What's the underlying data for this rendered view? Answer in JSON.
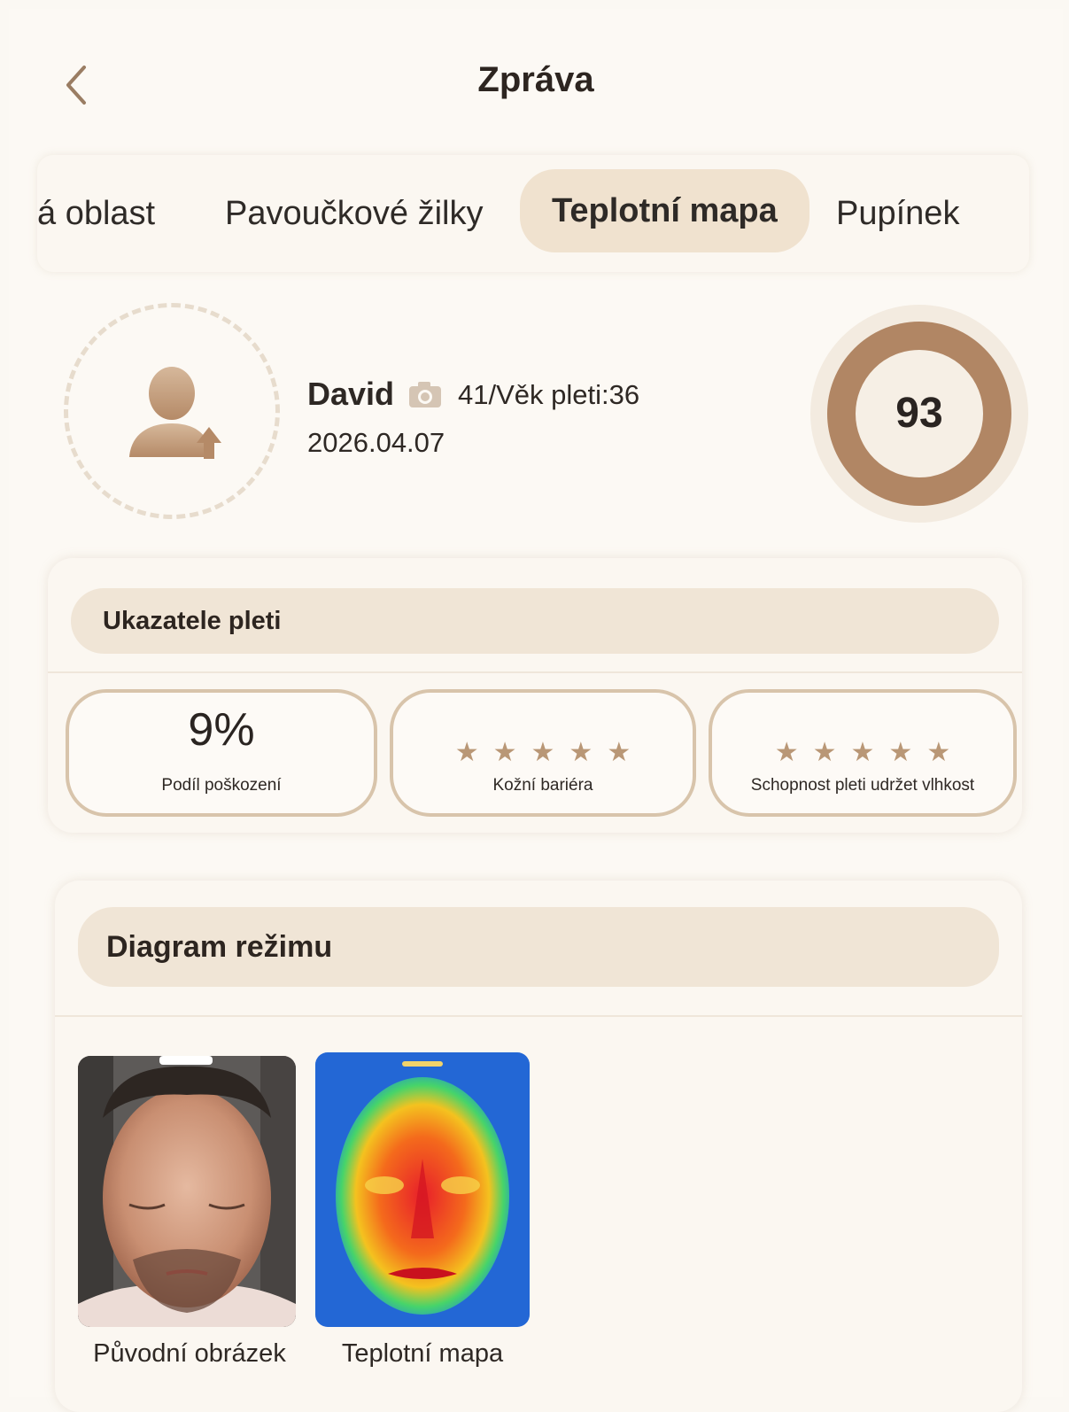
{
  "header": {
    "title": "Zpráva",
    "back_icon": "chevron-left-icon"
  },
  "tabs": [
    {
      "label": "á oblast",
      "active": false
    },
    {
      "label": "Pavoučkové žilky",
      "active": false
    },
    {
      "label": "Teplotní mapa",
      "active": true
    },
    {
      "label": "Pupínek",
      "active": false
    }
  ],
  "profile": {
    "name": "David",
    "age_info": "41/Věk pleti:36",
    "date": "2026.04.07",
    "score": "93",
    "camera_icon": "camera-icon",
    "avatar_icon": "user-upload-icon"
  },
  "indicators": {
    "title": "Ukazatele pleti",
    "metrics": [
      {
        "value": "9%",
        "label": "Podíl poškození"
      },
      {
        "stars": 5,
        "label": "Kožní bariéra"
      },
      {
        "stars": 5,
        "label": "Schopnost pleti udržet vlhkost"
      }
    ]
  },
  "diagram": {
    "title": "Diagram režimu",
    "images": [
      {
        "label": "Původní obrázek"
      },
      {
        "label": "Teplotní mapa"
      }
    ]
  },
  "colors": {
    "accent": "#b18664",
    "tab_active_bg": "#f0e2cf",
    "background": "#fcf9f4"
  }
}
